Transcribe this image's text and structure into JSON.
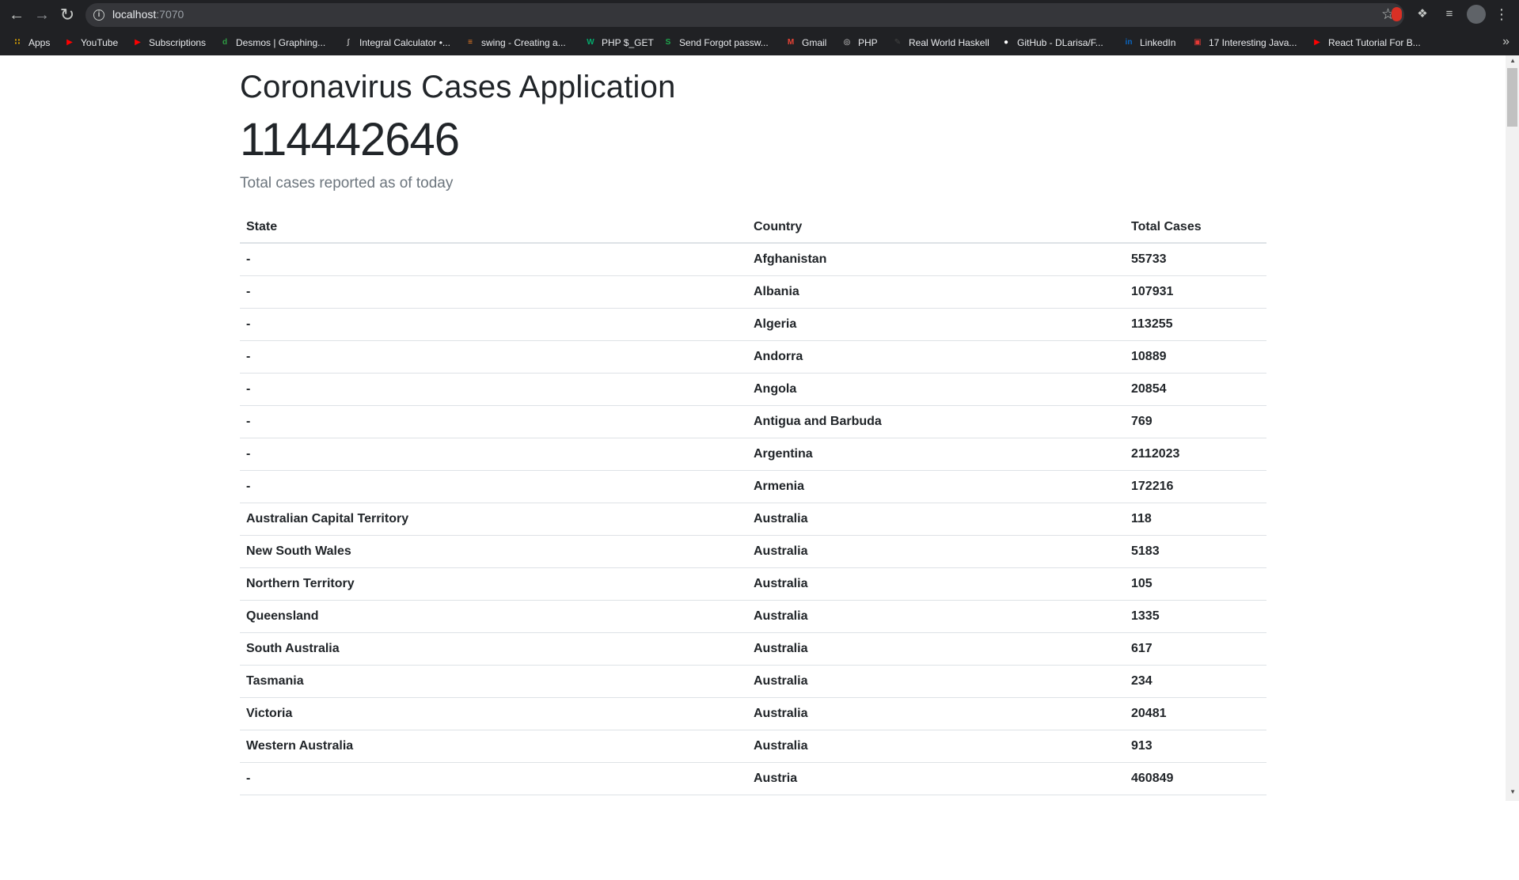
{
  "browser": {
    "url_host": "localhost",
    "url_port": ":7070",
    "bookmarks": [
      {
        "label": "Apps",
        "icon": "apps-grid-icon",
        "color": "#f4b400"
      },
      {
        "label": "YouTube",
        "icon": "youtube-icon",
        "color": "#ff0000"
      },
      {
        "label": "Subscriptions",
        "icon": "youtube-icon",
        "color": "#ff0000"
      },
      {
        "label": "Desmos | Graphing...",
        "icon": "desmos-icon",
        "color": "#2f9e44"
      },
      {
        "label": "Integral Calculator •...",
        "icon": "integral-icon",
        "color": "#aaaaaa"
      },
      {
        "label": "swing - Creating a...",
        "icon": "stackoverflow-icon",
        "color": "#f48024"
      },
      {
        "label": "PHP $_GET",
        "icon": "w3schools-icon",
        "color": "#04aa6d"
      },
      {
        "label": "Send Forgot passw...",
        "icon": "sitepoint-icon",
        "color": "#1fa84e"
      },
      {
        "label": "Gmail",
        "icon": "gmail-icon",
        "color": "#ea4335"
      },
      {
        "label": "PHP",
        "icon": "globe-icon",
        "color": "#dddddd"
      },
      {
        "label": "Real World Haskell",
        "icon": "pen-icon",
        "color": "#444444"
      },
      {
        "label": "GitHub - DLarisa/F...",
        "icon": "github-icon",
        "color": "#ffffff"
      },
      {
        "label": "LinkedIn",
        "icon": "linkedin-icon",
        "color": "#0a66c2"
      },
      {
        "label": "17 Interesting Java...",
        "icon": "article-icon",
        "color": "#e53935"
      },
      {
        "label": "React Tutorial For B...",
        "icon": "youtube-icon",
        "color": "#ff0000"
      }
    ]
  },
  "page": {
    "title": "Coronavirus Cases Application",
    "total_cases": "114442646",
    "subtitle": "Total cases reported as of today"
  },
  "table": {
    "headers": [
      "State",
      "Country",
      "Total Cases"
    ],
    "rows": [
      [
        "-",
        "Afghanistan",
        "55733"
      ],
      [
        "-",
        "Albania",
        "107931"
      ],
      [
        "-",
        "Algeria",
        "113255"
      ],
      [
        "-",
        "Andorra",
        "10889"
      ],
      [
        "-",
        "Angola",
        "20854"
      ],
      [
        "-",
        "Antigua and Barbuda",
        "769"
      ],
      [
        "-",
        "Argentina",
        "2112023"
      ],
      [
        "-",
        "Armenia",
        "172216"
      ],
      [
        "Australian Capital Territory",
        "Australia",
        "118"
      ],
      [
        "New South Wales",
        "Australia",
        "5183"
      ],
      [
        "Northern Territory",
        "Australia",
        "105"
      ],
      [
        "Queensland",
        "Australia",
        "1335"
      ],
      [
        "South Australia",
        "Australia",
        "617"
      ],
      [
        "Tasmania",
        "Australia",
        "234"
      ],
      [
        "Victoria",
        "Australia",
        "20481"
      ],
      [
        "Western Australia",
        "Australia",
        "913"
      ],
      [
        "-",
        "Austria",
        "460849"
      ]
    ]
  }
}
